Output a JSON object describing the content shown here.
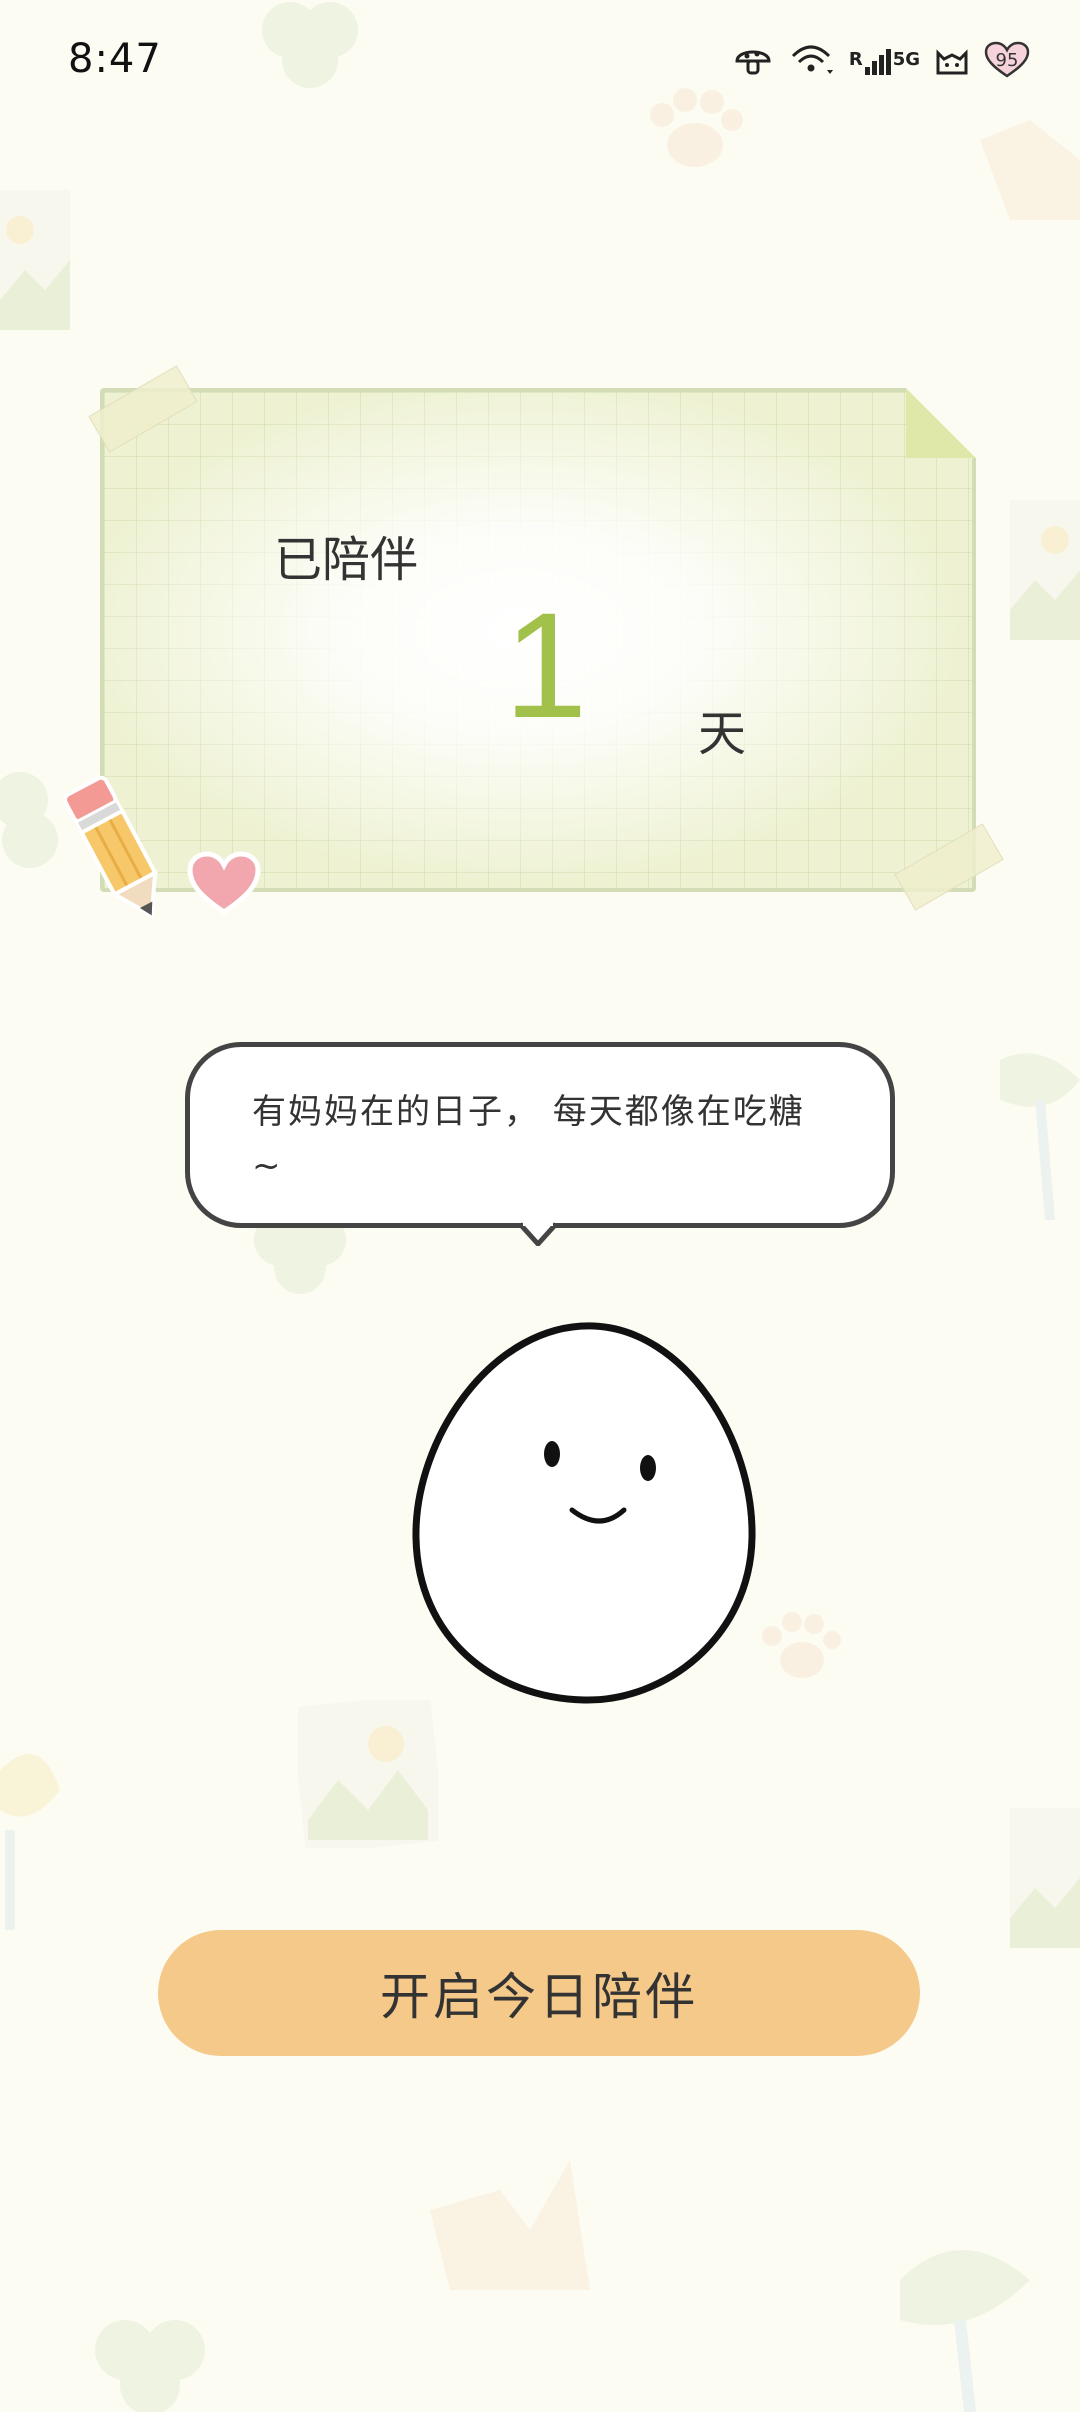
{
  "status_bar": {
    "time": "8:47",
    "network_label": "5G",
    "signal_label": "R",
    "battery_level": "95"
  },
  "card": {
    "label": "已陪伴",
    "days": "1",
    "unit": "天"
  },
  "bubble": {
    "text": "有妈妈在的日子，      每天都像在吃糖~"
  },
  "cta": {
    "label": "开启今日陪伴"
  },
  "colors": {
    "background": "#fdfcf3",
    "card_green": "#eef2d2",
    "number_green": "#a2c14b",
    "button_orange": "#f4c98a"
  },
  "icons": [
    "mushroom-icon",
    "wifi-icon",
    "signal-icon",
    "cat-icon",
    "battery-heart-icon"
  ]
}
